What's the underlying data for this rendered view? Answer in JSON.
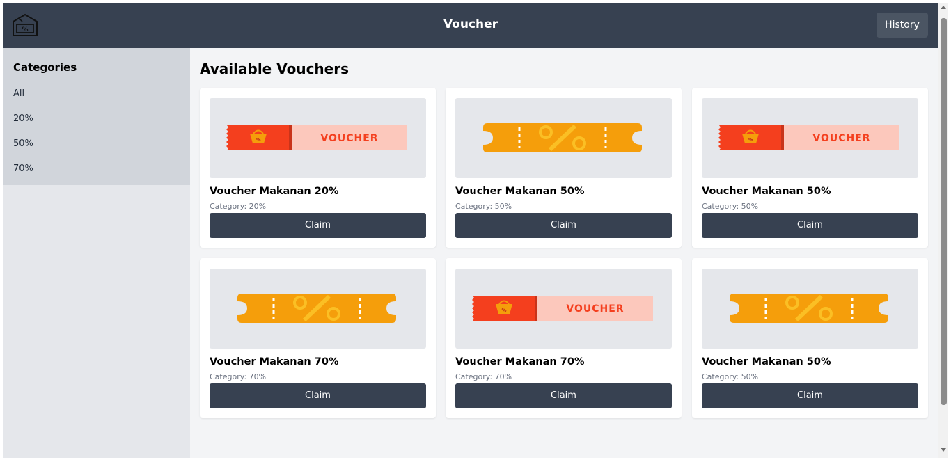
{
  "header": {
    "title": "Voucher",
    "history_label": "History",
    "logo_icon": "voucher-tag-logo-icon"
  },
  "sidebar": {
    "title": "Categories",
    "items": [
      "All",
      "20%",
      "50%",
      "70%"
    ]
  },
  "main": {
    "title": "Available Vouchers",
    "claim_label": "Claim",
    "vouchers": [
      {
        "name": "Voucher Makanan 20%",
        "category": "Category: 20%",
        "image": "red-voucher-ticket"
      },
      {
        "name": "Voucher Makanan 50%",
        "category": "Category: 50%",
        "image": "orange-percent-ticket"
      },
      {
        "name": "Voucher Makanan 50%",
        "category": "Category: 50%",
        "image": "red-voucher-ticket"
      },
      {
        "name": "Voucher Makanan 70%",
        "category": "Category: 70%",
        "image": "orange-percent-ticket"
      },
      {
        "name": "Voucher Makanan 70%",
        "category": "Category: 70%",
        "image": "red-voucher-ticket"
      },
      {
        "name": "Voucher Makanan 50%",
        "category": "Category: 50%",
        "image": "orange-percent-ticket"
      }
    ]
  },
  "images": {
    "red_ticket_text": "VOUCHER"
  },
  "colors": {
    "header_bg": "#374151",
    "page_bg": "#f3f4f6",
    "sidebar_bg": "#e5e7eb",
    "sidebar_active_bg": "#d1d5db",
    "button_bg": "#374151",
    "ticket_orange": "#f59e0b",
    "ticket_red": "#f43f1e",
    "ticket_pink": "#fcc8bc"
  }
}
